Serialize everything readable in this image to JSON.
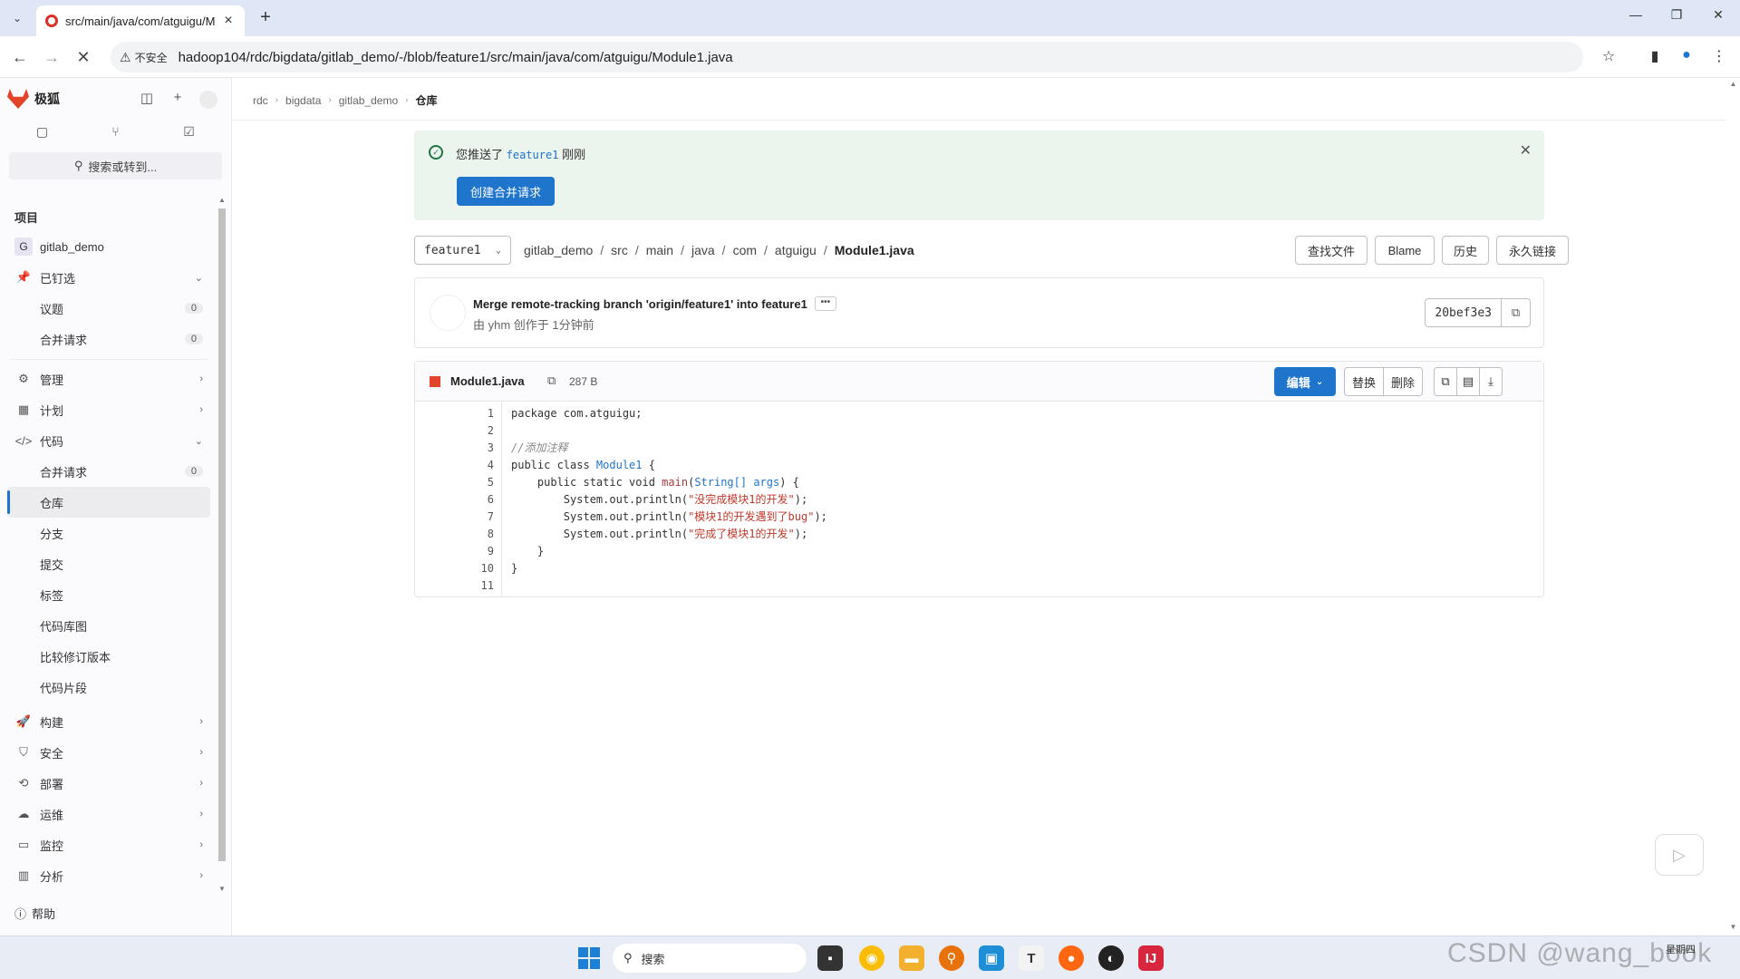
{
  "browser": {
    "tab_title": "src/main/java/com/atguigu/M",
    "security_label": "不安全",
    "url": "hadoop104/rdc/bigdata/gitlab_demo/-/blob/feature1/src/main/java/com/atguigu/Module1.java"
  },
  "sidebar": {
    "brand": "极狐",
    "search_label": "搜索或转到...",
    "section_title": "项目",
    "project": {
      "initial": "G",
      "name": "gitlab_demo"
    },
    "pinned": {
      "label": "已钉选",
      "items": [
        {
          "label": "议题",
          "count": "0"
        },
        {
          "label": "合并请求",
          "count": "0"
        }
      ]
    },
    "groups": [
      {
        "label": "管理"
      },
      {
        "label": "计划"
      }
    ],
    "code": {
      "label": "代码",
      "items": [
        {
          "label": "合并请求",
          "count": "0"
        },
        {
          "label": "仓库"
        },
        {
          "label": "分支"
        },
        {
          "label": "提交"
        },
        {
          "label": "标签"
        },
        {
          "label": "代码库图"
        },
        {
          "label": "比较修订版本"
        },
        {
          "label": "代码片段"
        }
      ]
    },
    "more_groups": [
      {
        "label": "构建"
      },
      {
        "label": "安全"
      },
      {
        "label": "部署"
      },
      {
        "label": "运维"
      },
      {
        "label": "监控"
      },
      {
        "label": "分析"
      }
    ],
    "help": "帮助"
  },
  "breadcrumb": [
    "rdc",
    "bigdata",
    "gitlab_demo",
    "仓库"
  ],
  "alert": {
    "prefix": "您推送了",
    "branch": "feature1",
    "suffix": "刚刚",
    "button": "创建合并请求"
  },
  "path": {
    "branch": "feature1",
    "segments": [
      "gitlab_demo",
      "src",
      "main",
      "java",
      "com",
      "atguigu"
    ],
    "file": "Module1.java"
  },
  "toolbar": {
    "find_file": "查找文件",
    "blame": "Blame",
    "history": "历史",
    "permalink": "永久链接"
  },
  "commit": {
    "title": "Merge remote-tracking branch 'origin/feature1' into feature1",
    "meta": "由 yhm 创作于 1分钟前",
    "sha": "20bef3e3"
  },
  "file": {
    "name": "Module1.java",
    "size": "287 B",
    "edit": "编辑",
    "replace": "替换",
    "delete": "删除",
    "lines": [
      "1",
      "2",
      "3",
      "4",
      "5",
      "6",
      "7",
      "8",
      "9",
      "10",
      "11"
    ],
    "code": {
      "l1": "package com.atguigu;",
      "l3": "//添加注释",
      "l4a": "public class ",
      "l4b": "Module1",
      "l4c": " {",
      "l5a": "    public static void ",
      "l5b": "main",
      "l5c": "(",
      "l5d": "String[] args",
      "l5e": ") {",
      "l6a": "        System.out.println(",
      "l6b": "\"没完成模块1的开发\"",
      "l6c": ");",
      "l7a": "        System.out.println(",
      "l7b": "\"模块1的开发遇到了bug\"",
      "l7c": ");",
      "l8a": "        System.out.println(",
      "l8b": "\"完成了模块1的开发\"",
      "l8c": ");",
      "l9": "    }",
      "l10": "}"
    }
  },
  "taskbar": {
    "search": "搜索",
    "watermark": "CSDN @wang_book",
    "weekday": "星期四"
  }
}
